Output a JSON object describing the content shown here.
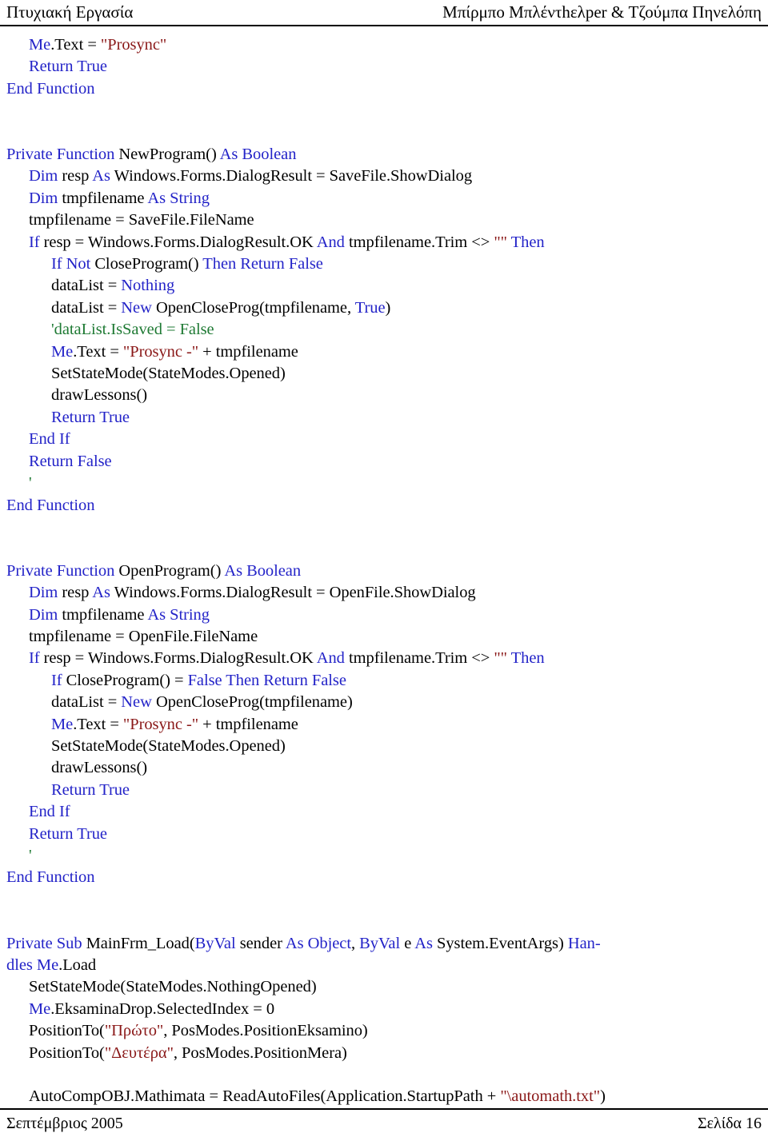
{
  "header": {
    "left": "Πτυχιακή Εργασία",
    "right": "Μπίρμπο Μπλέντhελper & Τζούμπα Πηνελόπη"
  },
  "footer": {
    "left": "Σεπτέμβριος 2005",
    "right": "Σελίδα 16"
  },
  "code": {
    "language": "Visual Basic .NET",
    "colors": {
      "keyword": "#2323C8",
      "string": "#8A1818",
      "comment": "#1F7A34",
      "plain": "#000000"
    },
    "lines": [
      {
        "indent": 1,
        "tokens": [
          {
            "t": "kw",
            "s": "Me"
          },
          {
            "t": "pln",
            "s": ".Text = "
          },
          {
            "t": "str",
            "s": "\"Prosync\""
          }
        ]
      },
      {
        "indent": 1,
        "tokens": [
          {
            "t": "kw",
            "s": "Return True"
          }
        ]
      },
      {
        "indent": 0,
        "tokens": [
          {
            "t": "kw",
            "s": "End Function"
          }
        ]
      },
      {
        "indent": 0,
        "tokens": []
      },
      {
        "indent": 0,
        "tokens": []
      },
      {
        "indent": 0,
        "tokens": [
          {
            "t": "kw",
            "s": "Private Function "
          },
          {
            "t": "pln",
            "s": "NewProgram() "
          },
          {
            "t": "kw",
            "s": "As Boolean"
          }
        ]
      },
      {
        "indent": 1,
        "tokens": [
          {
            "t": "kw",
            "s": "Dim "
          },
          {
            "t": "pln",
            "s": "resp "
          },
          {
            "t": "kw",
            "s": "As "
          },
          {
            "t": "pln",
            "s": "Windows.Forms.DialogResult = SaveFile.ShowDialog"
          }
        ]
      },
      {
        "indent": 1,
        "tokens": [
          {
            "t": "kw",
            "s": "Dim "
          },
          {
            "t": "pln",
            "s": "tmpfilename "
          },
          {
            "t": "kw",
            "s": "As String"
          }
        ]
      },
      {
        "indent": 1,
        "tokens": [
          {
            "t": "pln",
            "s": "tmpfilename = SaveFile.FileName"
          }
        ]
      },
      {
        "indent": 1,
        "tokens": [
          {
            "t": "kw",
            "s": "If "
          },
          {
            "t": "pln",
            "s": "resp = Windows.Forms.DialogResult.OK "
          },
          {
            "t": "kw",
            "s": "And "
          },
          {
            "t": "pln",
            "s": "tmpfilename.Trim <> "
          },
          {
            "t": "str",
            "s": "\"\" "
          },
          {
            "t": "kw",
            "s": "Then"
          }
        ]
      },
      {
        "indent": 2,
        "tokens": [
          {
            "t": "kw",
            "s": "If Not "
          },
          {
            "t": "pln",
            "s": "CloseProgram() "
          },
          {
            "t": "kw",
            "s": "Then Return False"
          }
        ]
      },
      {
        "indent": 2,
        "tokens": [
          {
            "t": "pln",
            "s": "dataList = "
          },
          {
            "t": "kw",
            "s": "Nothing"
          }
        ]
      },
      {
        "indent": 2,
        "tokens": [
          {
            "t": "pln",
            "s": "dataList = "
          },
          {
            "t": "kw",
            "s": "New "
          },
          {
            "t": "pln",
            "s": "OpenCloseProg(tmpfilename, "
          },
          {
            "t": "kw",
            "s": "True"
          },
          {
            "t": "pln",
            "s": ")"
          }
        ]
      },
      {
        "indent": 2,
        "tokens": [
          {
            "t": "cmt",
            "s": "'dataList.IsSaved = False"
          }
        ]
      },
      {
        "indent": 2,
        "tokens": [
          {
            "t": "kw",
            "s": "Me"
          },
          {
            "t": "pln",
            "s": ".Text = "
          },
          {
            "t": "str",
            "s": "\"Prosync -\""
          },
          {
            "t": "pln",
            "s": " + tmpfilename"
          }
        ]
      },
      {
        "indent": 2,
        "tokens": [
          {
            "t": "pln",
            "s": "SetStateMode(StateModes.Opened)"
          }
        ]
      },
      {
        "indent": 2,
        "tokens": [
          {
            "t": "pln",
            "s": "drawLessons()"
          }
        ]
      },
      {
        "indent": 2,
        "tokens": [
          {
            "t": "kw",
            "s": "Return True"
          }
        ]
      },
      {
        "indent": 1,
        "tokens": [
          {
            "t": "kw",
            "s": "End If"
          }
        ]
      },
      {
        "indent": 1,
        "tokens": [
          {
            "t": "kw",
            "s": "Return False"
          }
        ]
      },
      {
        "indent": 1,
        "tokens": [
          {
            "t": "cmt",
            "s": "'"
          }
        ]
      },
      {
        "indent": 0,
        "tokens": [
          {
            "t": "kw",
            "s": "End Function"
          }
        ]
      },
      {
        "indent": 0,
        "tokens": []
      },
      {
        "indent": 0,
        "tokens": []
      },
      {
        "indent": 0,
        "tokens": [
          {
            "t": "kw",
            "s": "Private Function "
          },
          {
            "t": "pln",
            "s": "OpenProgram() "
          },
          {
            "t": "kw",
            "s": "As Boolean"
          }
        ]
      },
      {
        "indent": 1,
        "tokens": [
          {
            "t": "kw",
            "s": "Dim "
          },
          {
            "t": "pln",
            "s": "resp "
          },
          {
            "t": "kw",
            "s": "As "
          },
          {
            "t": "pln",
            "s": "Windows.Forms.DialogResult = OpenFile.ShowDialog"
          }
        ]
      },
      {
        "indent": 1,
        "tokens": [
          {
            "t": "kw",
            "s": "Dim "
          },
          {
            "t": "pln",
            "s": "tmpfilename "
          },
          {
            "t": "kw",
            "s": "As String"
          }
        ]
      },
      {
        "indent": 1,
        "tokens": [
          {
            "t": "pln",
            "s": "tmpfilename = OpenFile.FileName"
          }
        ]
      },
      {
        "indent": 1,
        "tokens": [
          {
            "t": "kw",
            "s": "If "
          },
          {
            "t": "pln",
            "s": "resp = Windows.Forms.DialogResult.OK "
          },
          {
            "t": "kw",
            "s": "And "
          },
          {
            "t": "pln",
            "s": "tmpfilename.Trim <> "
          },
          {
            "t": "str",
            "s": "\"\" "
          },
          {
            "t": "kw",
            "s": "Then"
          }
        ]
      },
      {
        "indent": 2,
        "tokens": [
          {
            "t": "kw",
            "s": "If "
          },
          {
            "t": "pln",
            "s": "CloseProgram() = "
          },
          {
            "t": "kw",
            "s": "False Then Return False"
          }
        ]
      },
      {
        "indent": 2,
        "tokens": [
          {
            "t": "pln",
            "s": "dataList = "
          },
          {
            "t": "kw",
            "s": "New "
          },
          {
            "t": "pln",
            "s": "OpenCloseProg(tmpfilename)"
          }
        ]
      },
      {
        "indent": 2,
        "tokens": [
          {
            "t": "kw",
            "s": "Me"
          },
          {
            "t": "pln",
            "s": ".Text = "
          },
          {
            "t": "str",
            "s": "\"Prosync -\""
          },
          {
            "t": "pln",
            "s": " + tmpfilename"
          }
        ]
      },
      {
        "indent": 2,
        "tokens": [
          {
            "t": "pln",
            "s": "SetStateMode(StateModes.Opened)"
          }
        ]
      },
      {
        "indent": 2,
        "tokens": [
          {
            "t": "pln",
            "s": "drawLessons()"
          }
        ]
      },
      {
        "indent": 2,
        "tokens": [
          {
            "t": "kw",
            "s": "Return True"
          }
        ]
      },
      {
        "indent": 1,
        "tokens": [
          {
            "t": "kw",
            "s": "End If"
          }
        ]
      },
      {
        "indent": 1,
        "tokens": [
          {
            "t": "kw",
            "s": "Return True"
          }
        ]
      },
      {
        "indent": 1,
        "tokens": [
          {
            "t": "cmt",
            "s": "'"
          }
        ]
      },
      {
        "indent": 0,
        "tokens": [
          {
            "t": "kw",
            "s": "End Function"
          }
        ]
      },
      {
        "indent": 0,
        "tokens": []
      },
      {
        "indent": 0,
        "tokens": []
      },
      {
        "indent": 0,
        "tokens": [
          {
            "t": "kw",
            "s": "Private Sub "
          },
          {
            "t": "pln",
            "s": "MainFrm_Load("
          },
          {
            "t": "kw",
            "s": "ByVal "
          },
          {
            "t": "pln",
            "s": "sender "
          },
          {
            "t": "kw",
            "s": "As Object"
          },
          {
            "t": "pln",
            "s": ", "
          },
          {
            "t": "kw",
            "s": "ByVal "
          },
          {
            "t": "pln",
            "s": "e "
          },
          {
            "t": "kw",
            "s": "As "
          },
          {
            "t": "pln",
            "s": "System.EventArgs) "
          },
          {
            "t": "kw",
            "s": "Han-"
          }
        ]
      },
      {
        "indent": 0,
        "tokens": [
          {
            "t": "kw",
            "s": "dles Me"
          },
          {
            "t": "pln",
            "s": ".Load"
          }
        ]
      },
      {
        "indent": 1,
        "tokens": [
          {
            "t": "pln",
            "s": "SetStateMode(StateModes.NothingOpened)"
          }
        ]
      },
      {
        "indent": 1,
        "tokens": [
          {
            "t": "kw",
            "s": "Me"
          },
          {
            "t": "pln",
            "s": ".EksaminaDrop.SelectedIndex = 0"
          }
        ]
      },
      {
        "indent": 1,
        "tokens": [
          {
            "t": "pln",
            "s": "PositionTo("
          },
          {
            "t": "str",
            "s": "\"Πρώτο\""
          },
          {
            "t": "pln",
            "s": ", PosModes.PositionEksamino)"
          }
        ]
      },
      {
        "indent": 1,
        "tokens": [
          {
            "t": "pln",
            "s": "PositionTo("
          },
          {
            "t": "str",
            "s": "\"Δευτέρα\""
          },
          {
            "t": "pln",
            "s": ", PosModes.PositionMera)"
          }
        ]
      },
      {
        "indent": 1,
        "tokens": []
      },
      {
        "indent": 1,
        "tokens": [
          {
            "t": "pln",
            "s": "AutoCompOBJ.Mathimata = ReadAutoFiles(Application.StartupPath + "
          },
          {
            "t": "str",
            "s": "\"\\automath.txt\""
          },
          {
            "t": "pln",
            "s": ")"
          }
        ]
      }
    ]
  }
}
